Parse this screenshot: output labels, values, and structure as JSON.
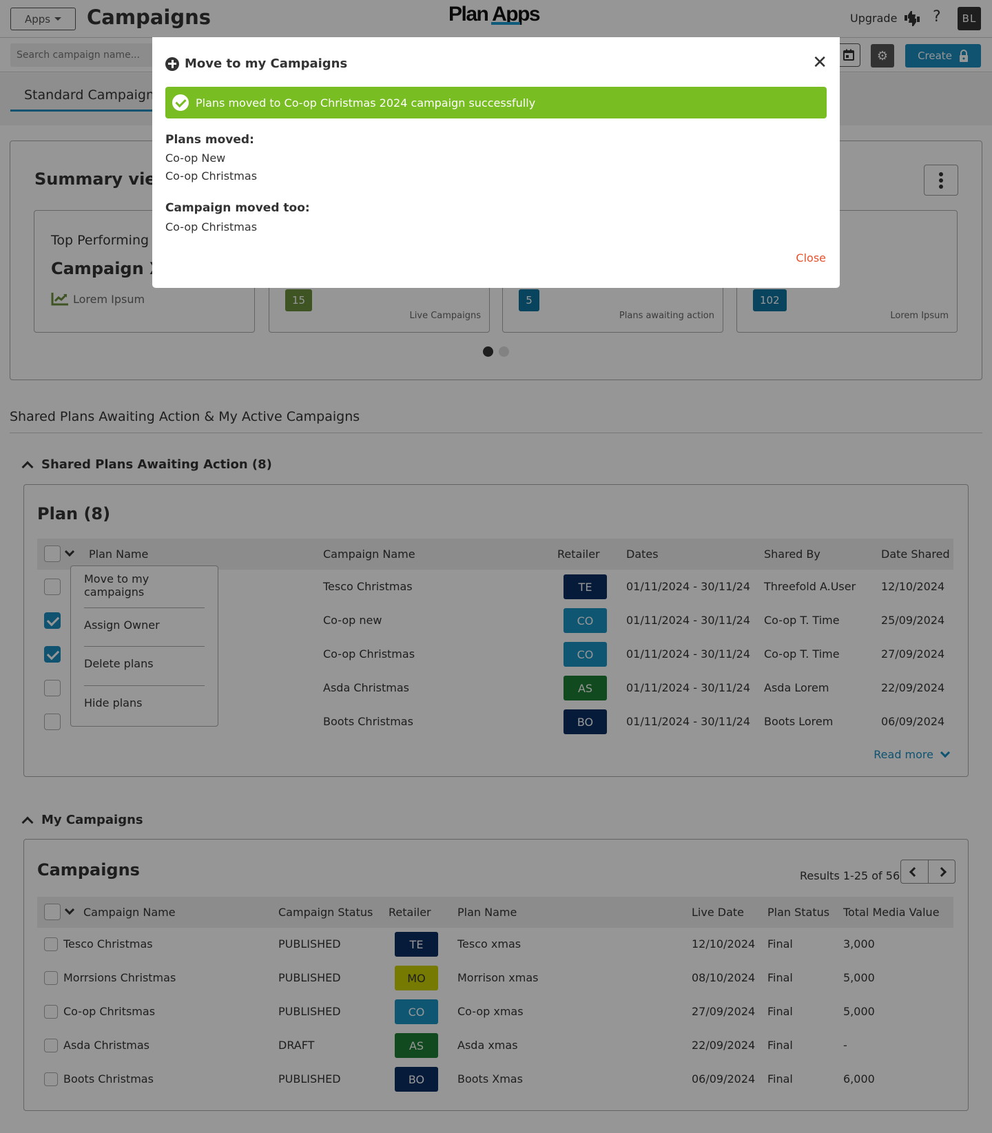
{
  "header": {
    "apps_label": "Apps",
    "title": "Campaigns",
    "logo_text": "Plan Apps",
    "upgrade_label": "Upgrade",
    "help_label": "?",
    "avatar_initials": "BL"
  },
  "toolbar": {
    "search_placeholder": "Search campaign name...",
    "create_label": "Create"
  },
  "tabs": [
    {
      "label": "Standard Campaigns",
      "active": true
    }
  ],
  "summary": {
    "title": "Summary view",
    "cards": [
      {
        "top_text": "Top Performing",
        "big_text": "Campaign X",
        "sub_text": "Lorem Ipsum"
      },
      {
        "value": "15",
        "label": "Live Campaigns",
        "color": "#6a8f3a"
      },
      {
        "value": "5",
        "label": "Plans awaiting action",
        "color": "#0e74a0"
      },
      {
        "value": "102",
        "label": "Lorem Ipsum",
        "color": "#0e74a0"
      }
    ],
    "carousel_page": 1,
    "carousel_pages": 2
  },
  "section_title": "Shared Plans Awaiting Action & My Active Campaigns",
  "shared_plans": {
    "heading": "Shared Plans Awaiting Action (8)",
    "panel_title": "Plan (8)",
    "columns": [
      "Plan Name",
      "Campaign Name",
      "Retailer",
      "Dates",
      "Shared By",
      "Date Shared"
    ],
    "rows": [
      {
        "checked": false,
        "campaign": "Tesco Christmas",
        "retailer": "TE",
        "retailer_color": "#0b2f63",
        "dates": "01/11/2024 - 30/11/24",
        "shared_by": "Threefold A.User",
        "date_shared": "12/10/2024"
      },
      {
        "checked": true,
        "campaign": "Co-op new",
        "retailer": "CO",
        "retailer_color": "#1a93c4",
        "dates": "01/11/2024 - 30/11/24",
        "shared_by": "Co-op T. Time",
        "date_shared": "25/09/2024"
      },
      {
        "checked": true,
        "campaign": "Co-op Christmas",
        "retailer": "CO",
        "retailer_color": "#1a93c4",
        "dates": "01/11/2024 - 30/11/24",
        "shared_by": "Co-op T. Time",
        "date_shared": "27/09/2024"
      },
      {
        "checked": false,
        "campaign": "Asda Christmas",
        "retailer": "AS",
        "retailer_color": "#1e7e34",
        "dates": "01/11/2024 - 30/11/24",
        "shared_by": "Asda Lorem",
        "date_shared": "22/09/2024"
      },
      {
        "checked": false,
        "campaign": "Boots Christmas",
        "retailer": "BO",
        "retailer_color": "#0b2f63",
        "dates": "01/11/2024 - 30/11/24",
        "shared_by": "Boots Lorem",
        "date_shared": "06/09/2024"
      }
    ],
    "bulk_menu": [
      "Move to my campaigns",
      "Assign Owner",
      "Delete plans",
      "Hide plans"
    ],
    "read_more_label": "Read more"
  },
  "my_campaigns": {
    "heading": "My Campaigns",
    "panel_title": "Campaigns",
    "results_text": "Results 1-25 of 56",
    "columns": [
      "Campaign Name",
      "Campaign Status",
      "Retailer",
      "Plan Name",
      "Live Date",
      "Plan Status",
      "Total Media Value"
    ],
    "rows": [
      {
        "name": "Tesco Christmas",
        "status": "PUBLISHED",
        "retailer": "TE",
        "retailer_color": "#0b2f63",
        "plan": "Tesco xmas",
        "live_date": "12/10/2024",
        "plan_status": "Final",
        "value": "3,000"
      },
      {
        "name": "Morrsions Christmas",
        "status": "PUBLISHED",
        "retailer": "MO",
        "retailer_color": "#c9d000",
        "plan": "Morrison xmas",
        "live_date": "08/10/2024",
        "plan_status": "Final",
        "value": "5,000"
      },
      {
        "name": "Co-op Chritsmas",
        "status": "PUBLISHED",
        "retailer": "CO",
        "retailer_color": "#1a93c4",
        "plan": "Co-op xmas",
        "live_date": "27/09/2024",
        "plan_status": "Final",
        "value": "5,000"
      },
      {
        "name": "Asda Christmas",
        "status": "DRAFT",
        "retailer": "AS",
        "retailer_color": "#1e7e34",
        "plan": "Asda xmas",
        "live_date": "22/09/2024",
        "plan_status": "Final",
        "value": "-"
      },
      {
        "name": "Boots Christmas",
        "status": "PUBLISHED",
        "retailer": "BO",
        "retailer_color": "#0b2f63",
        "plan": "Boots Xmas",
        "live_date": "06/09/2024",
        "plan_status": "Final",
        "value": "6,000"
      }
    ]
  },
  "modal": {
    "title": "Move to my Campaigns",
    "success_message": "Plans moved to Co-op Christmas 2024 campaign successfully",
    "plans_moved_label": "Plans moved:",
    "plans_moved": [
      "Co-op New",
      "Co-op Christmas"
    ],
    "campaign_moved_label": "Campaign moved too:",
    "campaign_moved": [
      "Co-op Christmas"
    ],
    "close_label": "Close",
    "success_color": "#78bd22",
    "close_color": "#e5522c"
  }
}
